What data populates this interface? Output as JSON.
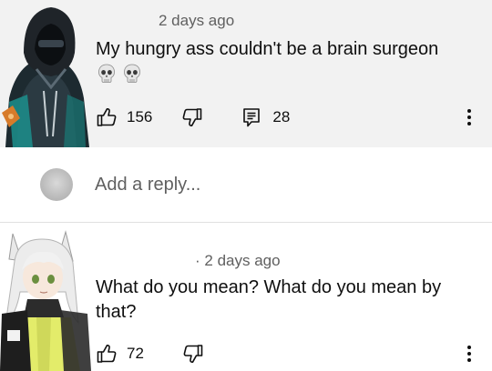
{
  "comments": [
    {
      "timestamp": "2 days ago",
      "text": "My hungry ass couldn't be a brain surgeon",
      "emojis": [
        "skull-icon",
        "skull-icon"
      ],
      "likes": "156",
      "replies": "28",
      "avatar": "hooded-figure-avatar"
    },
    {
      "timestamp": "2 days ago",
      "timestamp_prefix": "·",
      "text": "What do you mean? What do you mean by that?",
      "likes": "72",
      "avatar": "cat-eared-girl-avatar"
    }
  ],
  "reply_bar": {
    "placeholder": "Add a reply..."
  },
  "icons": {
    "like": "thumbs-up-icon",
    "dislike": "thumbs-down-icon",
    "reply": "comment-icon",
    "more": "more-vertical-icon"
  },
  "colors": {
    "comment_background": "#f2f2f2",
    "secondary_text": "#606060",
    "primary_text": "#0f0f0f"
  }
}
